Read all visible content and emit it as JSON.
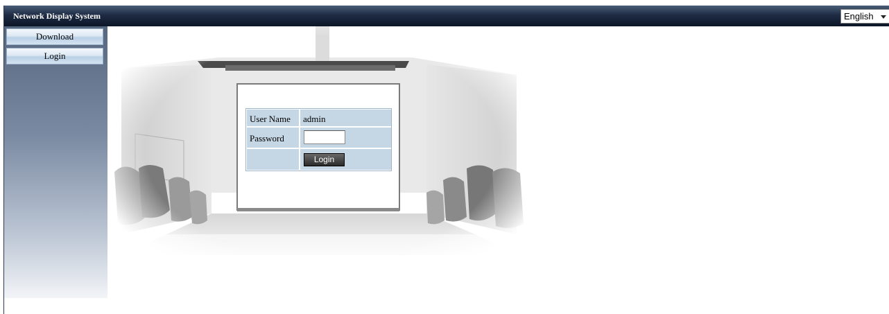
{
  "header": {
    "title": "Network Display System",
    "language": {
      "selected": "English"
    }
  },
  "sidebar": {
    "items": [
      {
        "label": "Download"
      },
      {
        "label": "Login"
      }
    ]
  },
  "login_form": {
    "username_label": "User Name",
    "username_value": "admin",
    "password_label": "Password",
    "password_value": "",
    "submit_label": "Login"
  },
  "colors": {
    "header_dark": "#0c1628",
    "sidebar_top": "#566780",
    "table_cell": "#c5d6e4"
  }
}
